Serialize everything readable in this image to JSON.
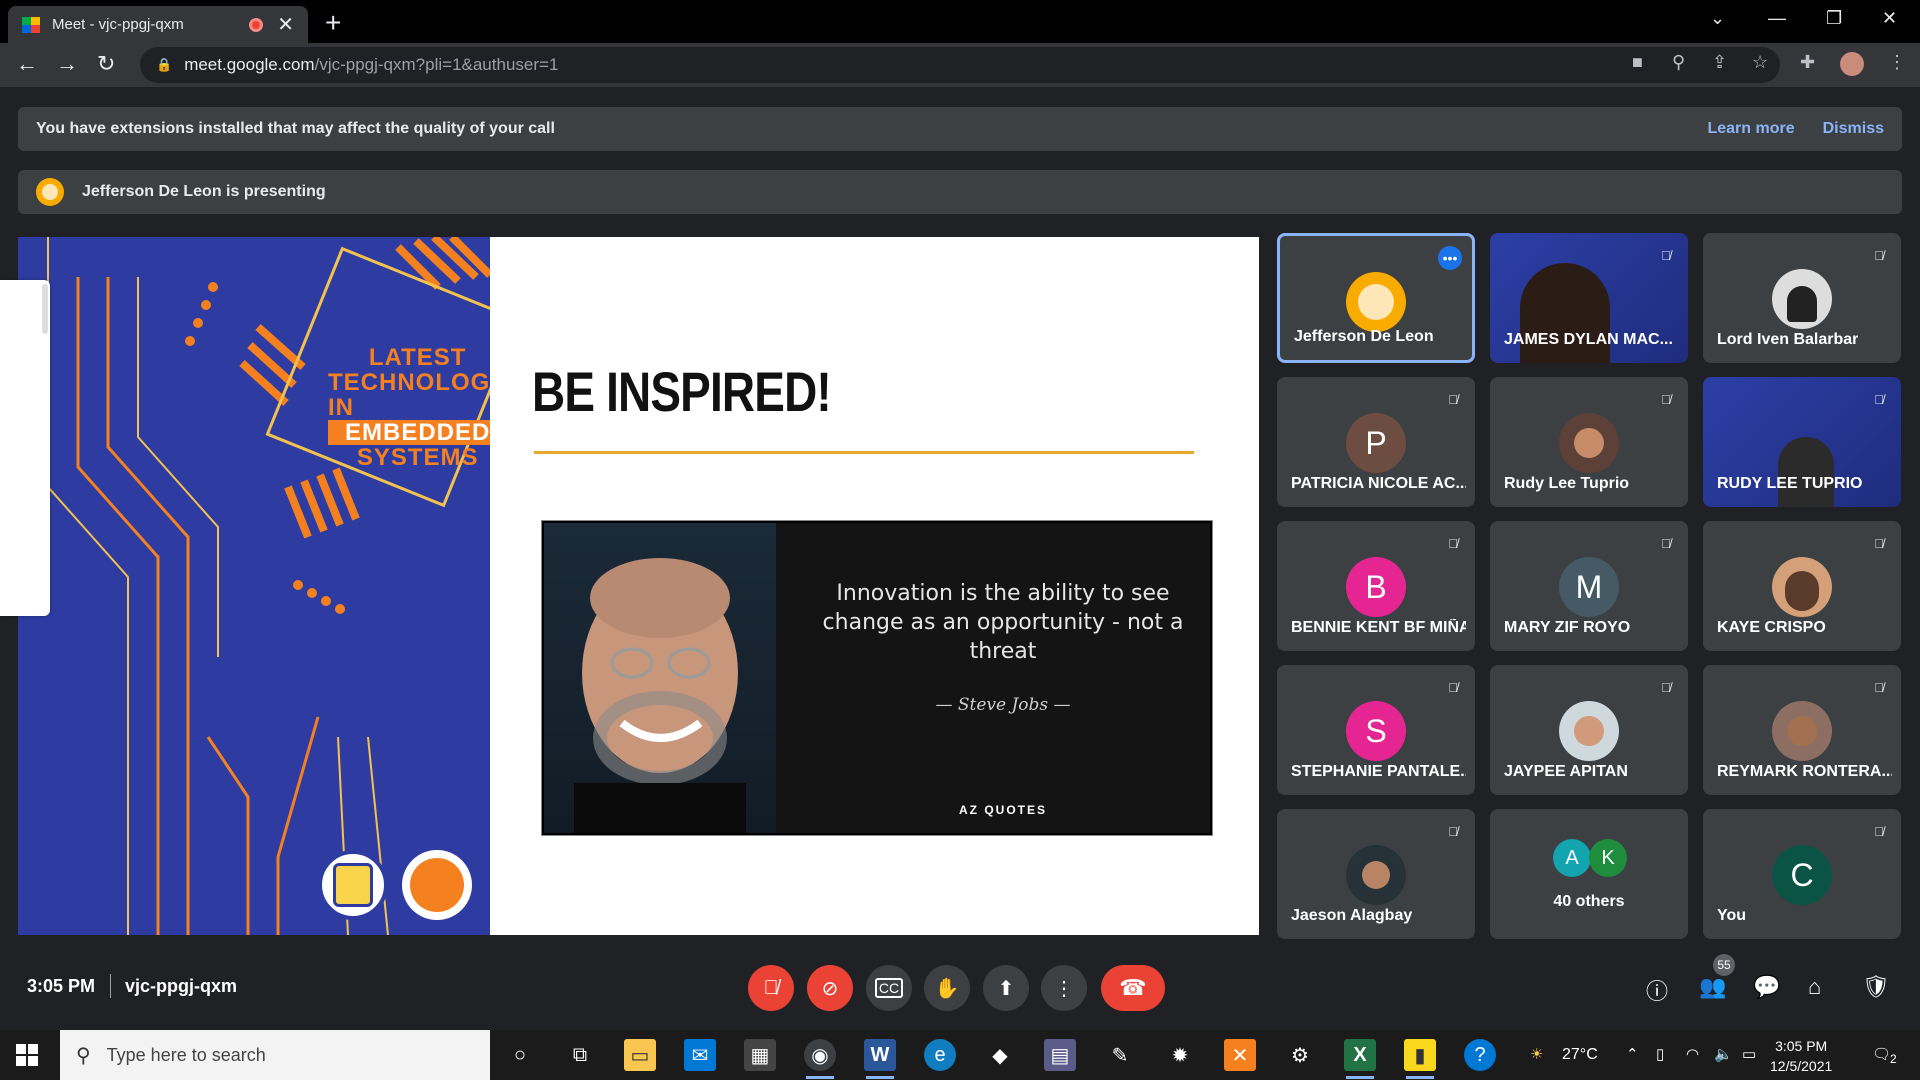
{
  "browser": {
    "tab_title": "Meet - vjc-ppgj-qxm",
    "url_domain": "meet.google.com",
    "url_path": "/vjc-ppgj-qxm?pli=1&authuser=1"
  },
  "banners": {
    "extensions_text": "You have extensions installed that may affect the quality of your call",
    "learn_more": "Learn more",
    "dismiss": "Dismiss",
    "presenting_text": "Jefferson De Leon is presenting"
  },
  "slide": {
    "left_title_lines": [
      "LATEST",
      "TECHNOLOGY",
      "IN",
      "EMBEDDED",
      "SYSTEMS"
    ],
    "heading": "BE INSPIRED!",
    "quote": "Innovation is the ability to see change as an opportunity - not a threat",
    "author": "— Steve Jobs —",
    "brand": "AZ QUOTES"
  },
  "participants": [
    {
      "name": "Jefferson De Leon",
      "type": "avatar-image",
      "color": "#f9ab00"
    },
    {
      "name": "JAMES DYLAN MAC...",
      "type": "video"
    },
    {
      "name": "Lord Iven Balarbar",
      "type": "avatar-image",
      "color": "#dddddd"
    },
    {
      "name": "PATRICIA NICOLE AC...",
      "type": "initial",
      "initial": "P",
      "color": "#6d4c41"
    },
    {
      "name": "Rudy Lee Tuprio",
      "type": "avatar-image",
      "color": "#5d4037"
    },
    {
      "name": "RUDY LEE TUPRIO",
      "type": "video"
    },
    {
      "name": "BENNIE KENT BF MIÑA",
      "type": "initial",
      "initial": "B",
      "color": "#e52592"
    },
    {
      "name": "MARY ZIF ROYO",
      "type": "initial",
      "initial": "M",
      "color": "#455a64"
    },
    {
      "name": "KAYE CRISPO",
      "type": "avatar-image",
      "color": "#d4a07a"
    },
    {
      "name": "STEPHANIE PANTALE...",
      "type": "initial",
      "initial": "S",
      "color": "#e52592"
    },
    {
      "name": "JAYPEE APITAN",
      "type": "avatar-image",
      "color": "#cfd8dc"
    },
    {
      "name": "REYMARK RONTERA...",
      "type": "avatar-image",
      "color": "#8d6e63"
    },
    {
      "name": "Jaeson Alagbay",
      "type": "avatar-image",
      "color": "#263238"
    },
    {
      "name": "40 others",
      "type": "others",
      "initials": [
        "A",
        "K"
      ],
      "colors": [
        "#12a4af",
        "#1e8e3e"
      ]
    },
    {
      "name": "You",
      "type": "initial",
      "initial": "C",
      "color": "#0b5345"
    }
  ],
  "meeting": {
    "time": "3:05 PM",
    "code": "vjc-ppgj-qxm",
    "participant_count": "55"
  },
  "taskbar": {
    "search_placeholder": "Type here to search",
    "temperature": "27°C",
    "time": "3:05 PM",
    "date": "12/5/2021",
    "notifications": "2"
  },
  "colors": {
    "accent": "#8ab4f8",
    "danger": "#ea4335",
    "slide_blue": "#2e3ca1",
    "slide_orange": "#f4801f"
  }
}
